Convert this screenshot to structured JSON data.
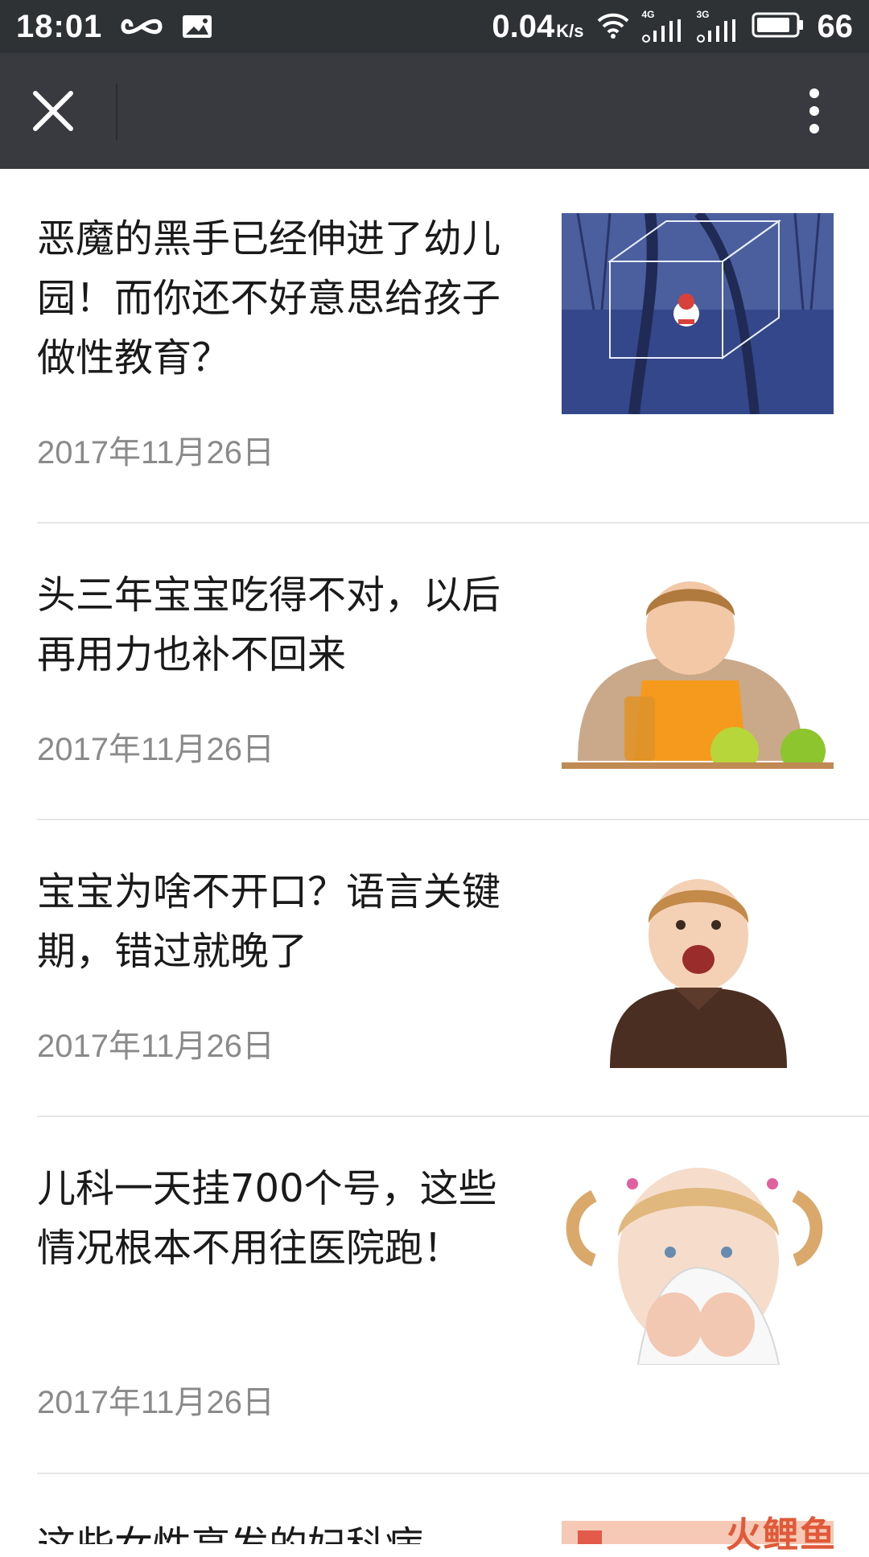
{
  "status_bar": {
    "time": "18:01",
    "speed": "0.04",
    "speed_unit": "K/s",
    "net_4g": "4G",
    "net_3g": "3G",
    "battery": "66",
    "icons": [
      "infinity-icon",
      "image-notification-icon",
      "wifi-icon",
      "signal-4g-icon",
      "signal-3g-icon",
      "battery-icon"
    ]
  },
  "title_bar": {
    "icons": [
      "close-icon",
      "more-vertical-icon"
    ],
    "background": "#393a3f"
  },
  "articles": [
    {
      "title": "恶魔的黑手已经伸进了幼儿园！而你还不好意思给孩子做性教育？",
      "date": "2017年11月26日"
    },
    {
      "title": "头三年宝宝吃得不对，以后再用力也补不回来",
      "date": "2017年11月26日"
    },
    {
      "title": "宝宝为啥不开口？语言关键期，错过就晚了",
      "date": "2017年11月26日"
    },
    {
      "title": "儿科一天挂700个号，这些情况根本不用往医院跑！",
      "date": "2017年11月26日"
    },
    {
      "title": "这些女性高发的妇科病",
      "date": ""
    }
  ],
  "watermark": "火鲤鱼",
  "colors": {
    "status_bar": "#2f3235",
    "title_text": "#1a1a1a",
    "date_text": "#8a8a8a",
    "divider": "#e6e6e6"
  }
}
